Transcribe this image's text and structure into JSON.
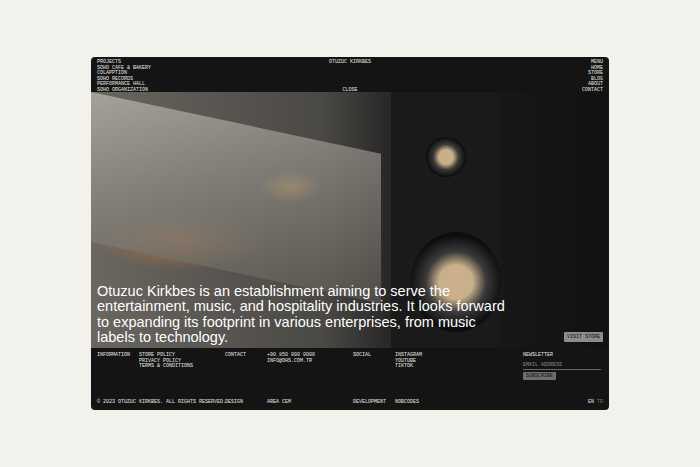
{
  "brand": "OTUZUC KIRKBES",
  "projects": {
    "title": "PROJECTS",
    "items": [
      "SOHO CAFE & BAKERY",
      "COLAPPTION",
      "SOHO RECORDS",
      "PERFORMANCE HALL",
      "SOHO ORGANIZATION"
    ]
  },
  "close": "CLOSE",
  "menu": {
    "title": "MENU",
    "items": [
      "HOME",
      "STORE",
      "BLOG",
      "ABOUT",
      "CONTACT"
    ]
  },
  "hero": {
    "text": "Otuzuc Kirkbes is an establishment aiming to serve the entertainment, music, and hospitality industries. It looks forward to expanding its footprint in various enterprises, from music labels to technology.",
    "button": "VISIT STORE"
  },
  "footer": {
    "columns": [
      {
        "label": "INFORMATION",
        "items": [
          "STORE POLICY",
          "PRIVACY POLICY",
          "TERMS & CONDITIONS"
        ]
      },
      {
        "label": "CONTACT",
        "items": [
          "+90 850 000 0000",
          "INFO@OHS.COM.TR"
        ]
      },
      {
        "label": "SOCIAL",
        "items": [
          "INSTAGRAM",
          "YOUTUBE",
          "TIKTOK"
        ]
      }
    ],
    "newsletter": {
      "label": "NEWSLETTER",
      "placeholder": "EMAIL ADDRESS",
      "button": "SUBSCRIBE"
    },
    "copyright": "© 2023 OTUZUC KIRKBES. ALL RIGHTS RESERVED.",
    "credits": [
      {
        "label": "DESIGN",
        "value": "AREA CEM"
      },
      {
        "label": "DEVELOPMENT",
        "value": "NOBCODES"
      }
    ],
    "languages": [
      {
        "label": "EN",
        "selected": true
      },
      {
        "label": "TR",
        "selected": false
      }
    ]
  }
}
